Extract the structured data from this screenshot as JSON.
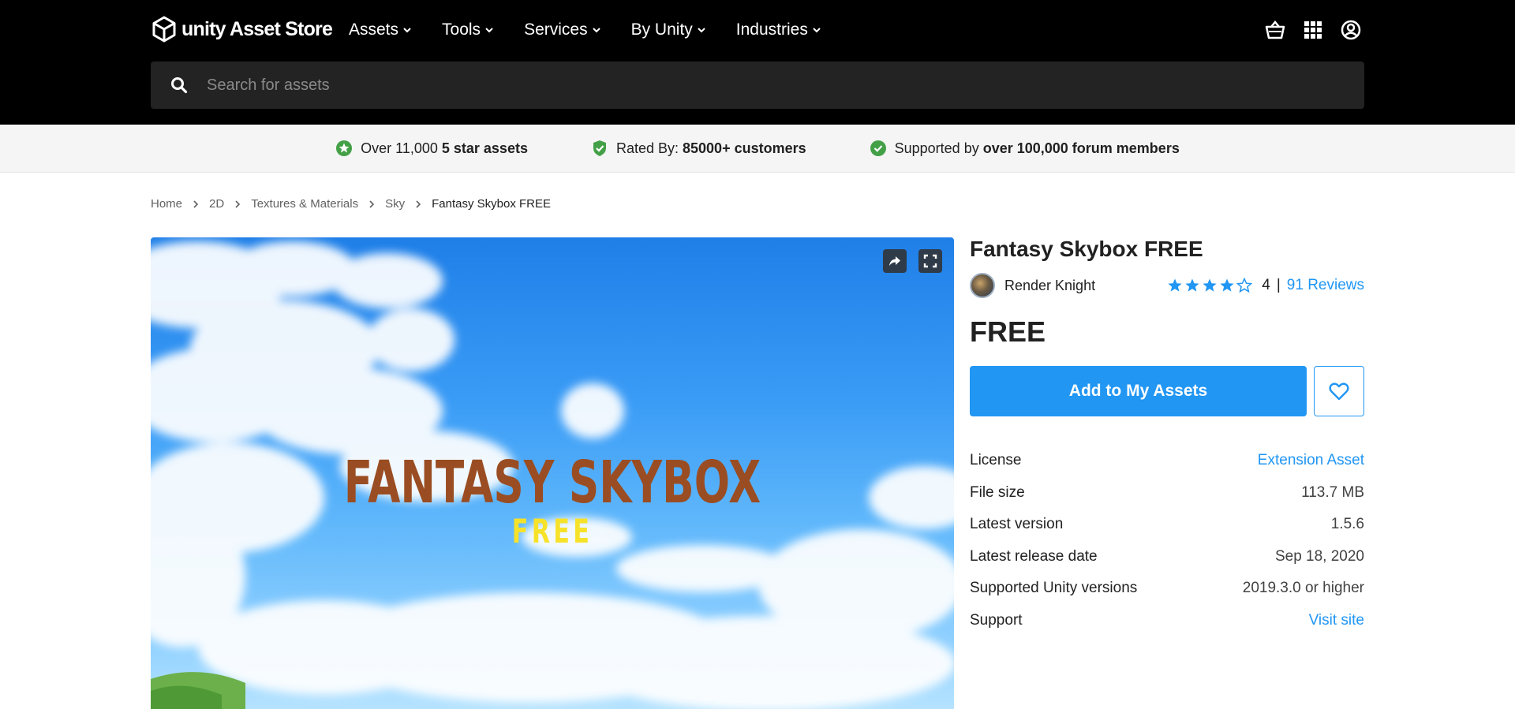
{
  "header": {
    "logo_text": "unity Asset Store",
    "nav": [
      {
        "label": "Assets"
      },
      {
        "label": "Tools"
      },
      {
        "label": "Services"
      },
      {
        "label": "By Unity"
      },
      {
        "label": "Industries"
      }
    ],
    "icons": [
      "cart-icon",
      "apps-grid-icon",
      "account-icon"
    ]
  },
  "search": {
    "placeholder": "Search for assets",
    "value": ""
  },
  "trust_bar": {
    "item1": {
      "text": "Over 11,000",
      "bold": "5 star assets"
    },
    "item2": {
      "text": "Rated By:",
      "bold": "85000+ customers"
    },
    "item3": {
      "text": "Supported by",
      "bold": "over 100,000 forum members"
    }
  },
  "breadcrumb": {
    "items": [
      "Home",
      "2D",
      "Textures & Materials",
      "Sky"
    ],
    "current": "Fantasy Skybox FREE"
  },
  "hero": {
    "title": "FANTASY SKYBOX",
    "subtitle": "FREE"
  },
  "product": {
    "title": "Fantasy Skybox FREE",
    "publisher": "Render Knight",
    "rating": 4,
    "rating_max": 5,
    "rating_value_text": "4",
    "rating_separator": "|",
    "reviews_label": "91 Reviews",
    "price": "FREE",
    "add_button_label": "Add to My Assets",
    "details": [
      {
        "label": "License",
        "value": "Extension Asset",
        "link": true
      },
      {
        "label": "File size",
        "value": "113.7 MB",
        "link": false
      },
      {
        "label": "Latest version",
        "value": "1.5.6",
        "link": false
      },
      {
        "label": "Latest release date",
        "value": "Sep 18, 2020",
        "link": false
      },
      {
        "label": "Supported Unity versions",
        "value": "2019.3.0 or higher",
        "link": false
      },
      {
        "label": "Support",
        "value": "Visit site",
        "link": true
      }
    ]
  },
  "colors": {
    "accent": "#2196f3",
    "header_bg": "#000000",
    "trust_check": "#43a047",
    "hero_title": "#9a4d22",
    "hero_subtitle": "#f7e22a"
  }
}
